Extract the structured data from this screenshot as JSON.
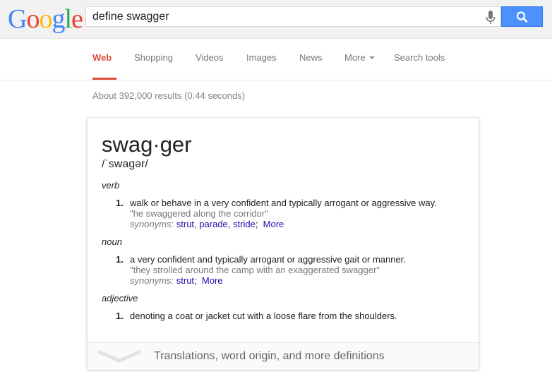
{
  "header": {
    "logo_text": "Google",
    "search_value": "define swagger",
    "colors": {
      "blue": "#4285f4",
      "red": "#ea4335",
      "yellow": "#fbbc05",
      "green": "#34a853",
      "search_button": "#4d90fe"
    }
  },
  "nav": {
    "tabs": [
      {
        "label": "Web",
        "active": true
      },
      {
        "label": "Shopping"
      },
      {
        "label": "Videos"
      },
      {
        "label": "Images"
      },
      {
        "label": "News"
      },
      {
        "label": "More"
      },
      {
        "label": "Search tools"
      }
    ]
  },
  "results": {
    "stats": "About 392,000 results (0.44 seconds)"
  },
  "definition": {
    "word": "swag·ger",
    "pronunciation": "/ˈswagər/",
    "senses": [
      {
        "pos": "verb",
        "number": "1.",
        "definition": "walk or behave in a very confident and typically arrogant or aggressive way.",
        "example": "\"he swaggered along the corridor\"",
        "synonyms_label": "synonyms:",
        "synonyms": [
          "strut",
          "parade",
          "stride"
        ],
        "more": "More"
      },
      {
        "pos": "noun",
        "number": "1.",
        "definition": "a very confident and typically arrogant or aggressive gait or manner.",
        "example": "\"they strolled around the camp with an exaggerated swagger\"",
        "synonyms_label": "synonyms:",
        "synonyms": [
          "strut"
        ],
        "more": "More"
      },
      {
        "pos": "adjective",
        "number": "1.",
        "definition": "denoting a coat or jacket cut with a loose flare from the shoulders."
      }
    ],
    "more_definitions": "Translations, word origin, and more definitions"
  }
}
